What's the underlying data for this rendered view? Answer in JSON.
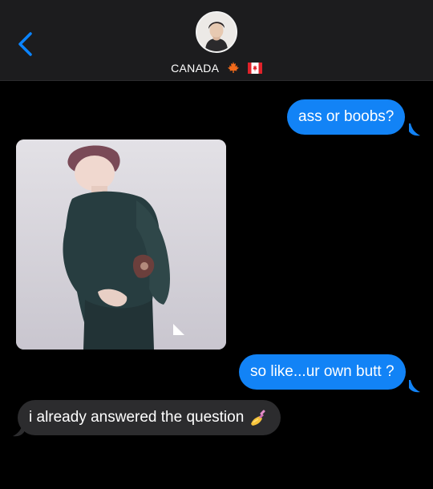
{
  "header": {
    "contact_name": "CANADA",
    "back_icon": "chevron-left-icon",
    "emojis": [
      "maple-leaf-icon",
      "canada-flag-icon"
    ]
  },
  "messages": [
    {
      "direction": "outgoing",
      "text": "ass or boobs?"
    },
    {
      "direction": "incoming",
      "type": "photo",
      "description_icon": "photo-attachment"
    },
    {
      "direction": "outgoing",
      "text": "so like...ur own butt ?"
    },
    {
      "direction": "incoming",
      "text": "i already answered the question",
      "emoji": "nail-polish-icon"
    }
  ],
  "colors": {
    "outgoing_bubble": "#1283f6",
    "incoming_bubble": "#2c2c2e",
    "header_bg": "#1c1c1e",
    "accent": "#0a84ff"
  }
}
